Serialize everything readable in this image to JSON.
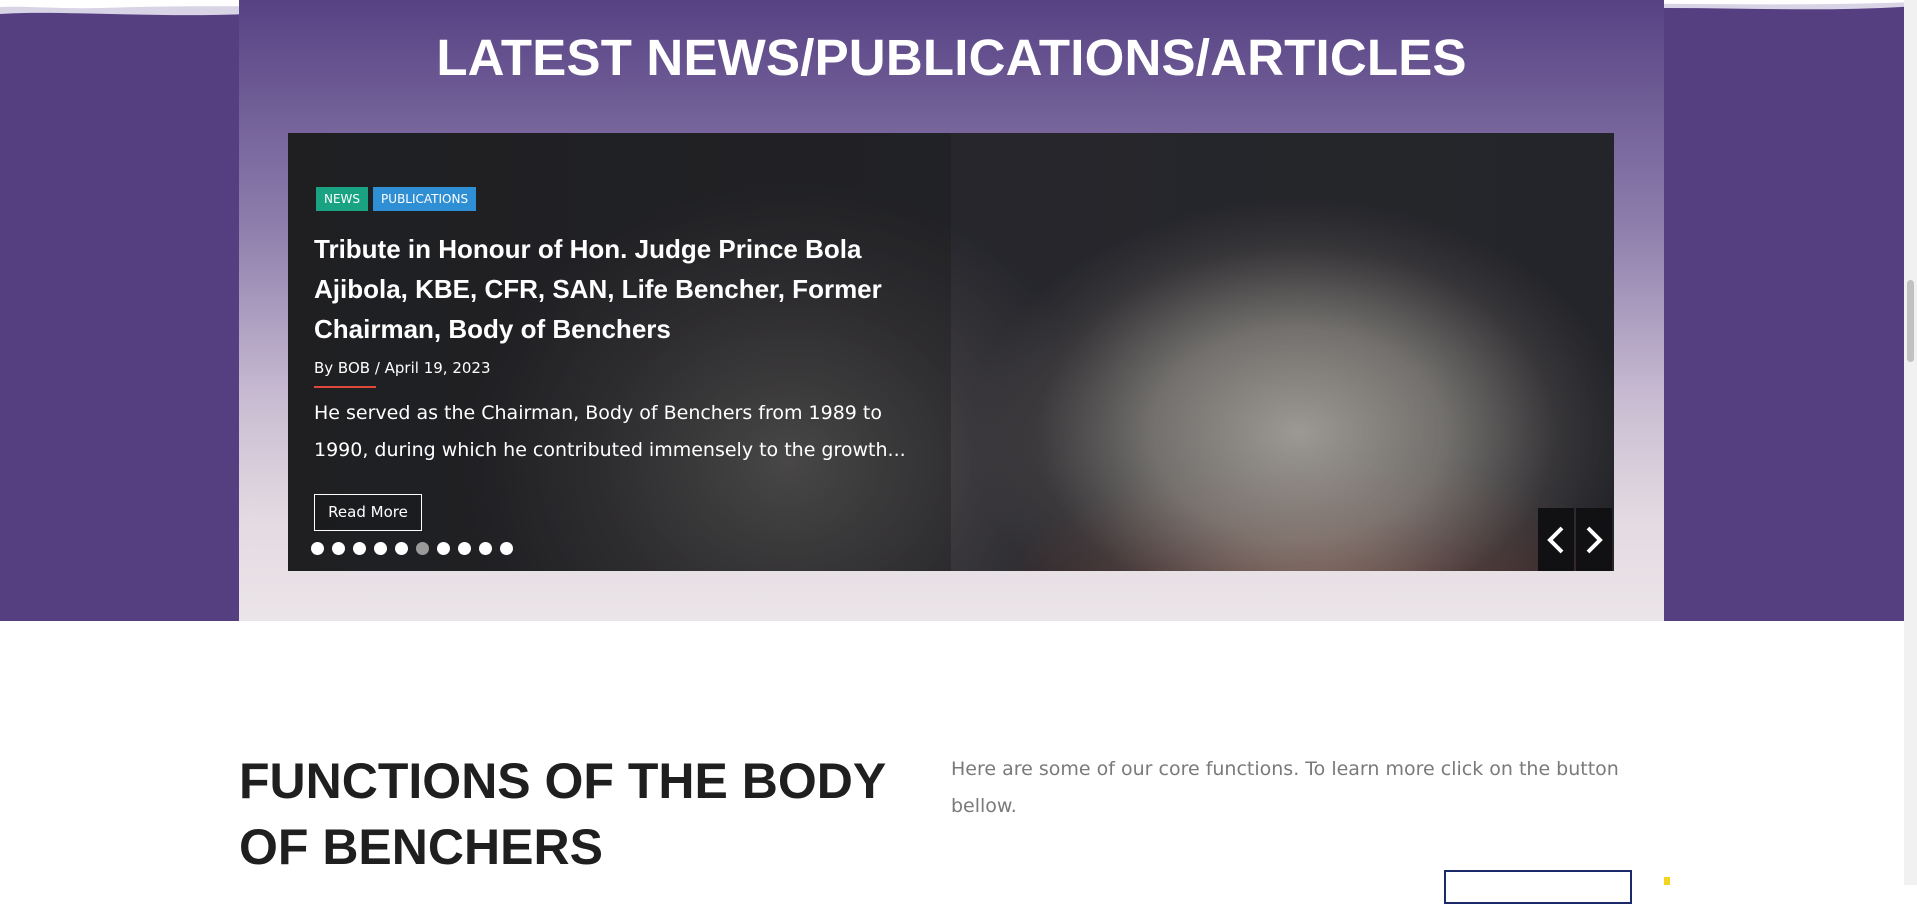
{
  "news_section": {
    "title": "LATEST NEWS/PUBLICATIONS/ARTICLES",
    "slide": {
      "tags": [
        "NEWS",
        "PUBLICATIONS"
      ],
      "tag_colors": {
        "news": "#1aa383",
        "publications": "#2f8fd4"
      },
      "title": "Tribute in Honour of Hon. Judge Prince Bola Ajibola, KBE, CFR, SAN, Life Bencher, Former Chairman, Body of Benchers",
      "meta": "By BOB / April 19, 2023",
      "excerpt": "He served as the Chairman, Body of Benchers from 1989 to 1990, during which he contributed immensely to the growth...",
      "read_more_label": "Read More"
    },
    "pagination": {
      "total": 10,
      "active_index": 5
    },
    "nav": {
      "prev_icon": "chevron-left-icon",
      "next_icon": "chevron-right-icon"
    }
  },
  "functions_section": {
    "title": "FUNCTIONS OF THE BODY OF BENCHERS",
    "description": "Here are some of our core functions. To learn more click on the button bellow."
  },
  "colors": {
    "band_purple": "#553f80",
    "accent_red": "#e0483c",
    "button_border_navy": "#1c2a6b",
    "accent_yellow": "#f3d51e"
  }
}
